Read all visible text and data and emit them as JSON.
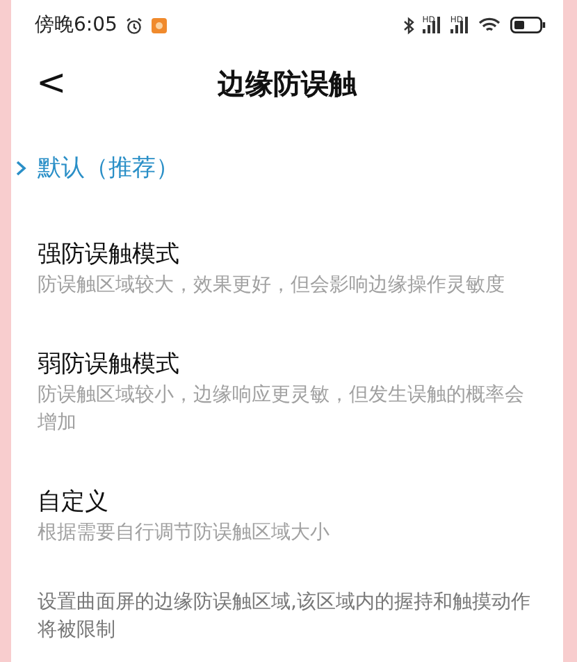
{
  "status_bar": {
    "time": "傍晚6:05",
    "signals": [
      {
        "label": "HD"
      },
      {
        "label": "HD"
      }
    ]
  },
  "header": {
    "back": "<",
    "title": "边缘防误触"
  },
  "options": [
    {
      "title": "默认（推荐）",
      "selected": true
    },
    {
      "title": "强防误触模式",
      "description": "防误触区域较大，效果更好，但会影响边缘操作灵敏度",
      "selected": false
    },
    {
      "title": "弱防误触模式",
      "description": "防误触区域较小，边缘响应更灵敏，但发生误触的概率会增加",
      "selected": false
    },
    {
      "title": "自定义",
      "description": "根据需要自行调节防误触区域大小",
      "selected": false
    }
  ],
  "footer": "设置曲面屏的边缘防误触区域,该区域内的握持和触摸动作将被限制"
}
